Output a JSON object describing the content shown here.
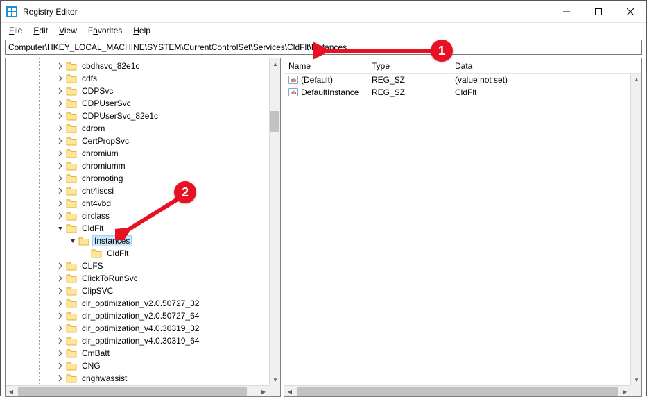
{
  "window": {
    "title": "Registry Editor"
  },
  "menu": {
    "file": "File",
    "edit": "Edit",
    "view": "View",
    "favorites": "Favorites",
    "help": "Help"
  },
  "address": "Computer\\HKEY_LOCAL_MACHINE\\SYSTEM\\CurrentControlSet\\Services\\CldFlt\\Instances",
  "tree": {
    "items": [
      {
        "label": "cbdhsvc_82e1c",
        "depth": 4,
        "expander": "right"
      },
      {
        "label": "cdfs",
        "depth": 4,
        "expander": "right"
      },
      {
        "label": "CDPSvc",
        "depth": 4,
        "expander": "right"
      },
      {
        "label": "CDPUserSvc",
        "depth": 4,
        "expander": "right"
      },
      {
        "label": "CDPUserSvc_82e1c",
        "depth": 4,
        "expander": "right"
      },
      {
        "label": "cdrom",
        "depth": 4,
        "expander": "right"
      },
      {
        "label": "CertPropSvc",
        "depth": 4,
        "expander": "right"
      },
      {
        "label": "chromium",
        "depth": 4,
        "expander": "right"
      },
      {
        "label": "chromiumm",
        "depth": 4,
        "expander": "right"
      },
      {
        "label": "chromoting",
        "depth": 4,
        "expander": "right"
      },
      {
        "label": "cht4iscsi",
        "depth": 4,
        "expander": "right"
      },
      {
        "label": "cht4vbd",
        "depth": 4,
        "expander": "right"
      },
      {
        "label": "circlass",
        "depth": 4,
        "expander": "right"
      },
      {
        "label": "CldFlt",
        "depth": 4,
        "expander": "down"
      },
      {
        "label": "Instances",
        "depth": 5,
        "expander": "down",
        "selected": true
      },
      {
        "label": "CldFlt",
        "depth": 6,
        "expander": "none"
      },
      {
        "label": "CLFS",
        "depth": 4,
        "expander": "right"
      },
      {
        "label": "ClickToRunSvc",
        "depth": 4,
        "expander": "right"
      },
      {
        "label": "ClipSVC",
        "depth": 4,
        "expander": "right"
      },
      {
        "label": "clr_optimization_v2.0.50727_32",
        "depth": 4,
        "expander": "right"
      },
      {
        "label": "clr_optimization_v2.0.50727_64",
        "depth": 4,
        "expander": "right"
      },
      {
        "label": "clr_optimization_v4.0.30319_32",
        "depth": 4,
        "expander": "right"
      },
      {
        "label": "clr_optimization_v4.0.30319_64",
        "depth": 4,
        "expander": "right"
      },
      {
        "label": "CmBatt",
        "depth": 4,
        "expander": "right"
      },
      {
        "label": "CNG",
        "depth": 4,
        "expander": "right"
      },
      {
        "label": "cnghwassist",
        "depth": 4,
        "expander": "right"
      }
    ]
  },
  "list": {
    "columns": {
      "name": "Name",
      "type": "Type",
      "data": "Data"
    },
    "rows": [
      {
        "name": "(Default)",
        "type": "REG_SZ",
        "data": "(value not set)"
      },
      {
        "name": "DefaultInstance",
        "type": "REG_SZ",
        "data": "CldFlt"
      }
    ]
  },
  "annotations": {
    "badge1": "1",
    "badge2": "2"
  }
}
